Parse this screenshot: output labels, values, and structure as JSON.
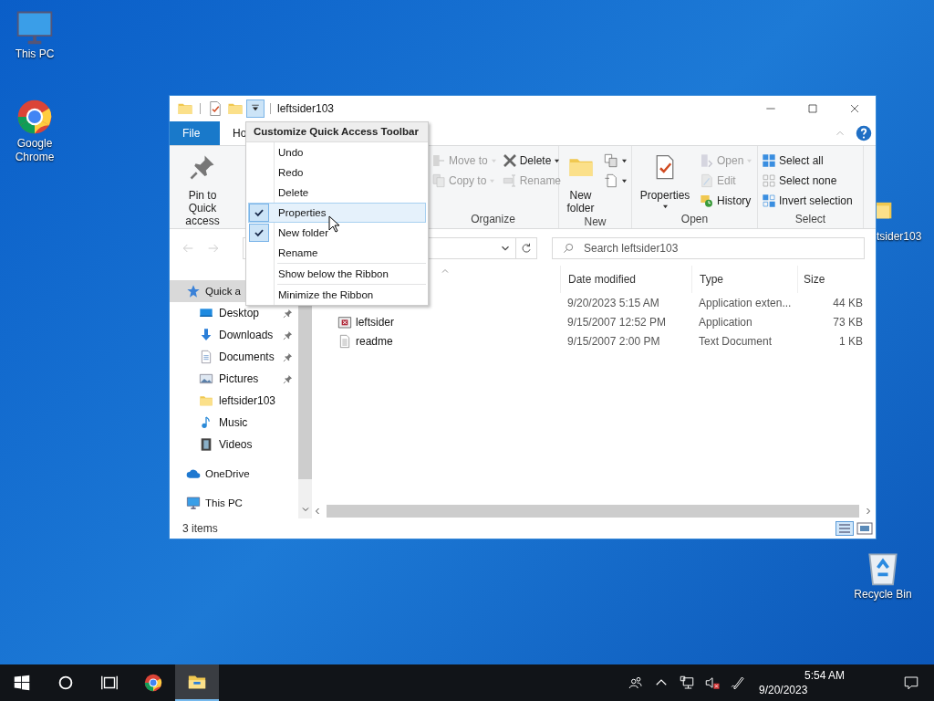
{
  "desktop_icons": [
    {
      "label": "This PC"
    },
    {
      "label": "Google Chrome"
    },
    {
      "label": "tsider103"
    },
    {
      "label": "Recycle Bin"
    }
  ],
  "window": {
    "title": "leftsider103",
    "tabs": [
      {
        "label": "File",
        "kind": "file"
      },
      {
        "label": "Ho",
        "kind": "tab"
      }
    ],
    "ribbon": [
      {
        "items": [
          {
            "label": "Pin to Quick access",
            "kind": "large",
            "disabled": false,
            "dropdown": false
          }
        ]
      },
      {
        "label": "Organize",
        "items": [
          {
            "label": "Move to",
            "kind": "small",
            "disabled": true,
            "dropdown": true
          },
          {
            "label": "Copy to",
            "kind": "small",
            "disabled": true,
            "dropdown": true
          },
          {
            "label": "Delete",
            "kind": "small",
            "disabled": false,
            "dropdown": true
          },
          {
            "label": "Rename",
            "kind": "small",
            "disabled": true,
            "dropdown": false
          }
        ]
      },
      {
        "label": "New",
        "items": [
          {
            "label": "New folder",
            "kind": "large",
            "disabled": false,
            "dropdown": false
          },
          {
            "kind": "small",
            "disabled": false,
            "dropdown": true
          },
          {
            "kind": "small",
            "disabled": false,
            "dropdown": true
          }
        ]
      },
      {
        "label": "Open",
        "items": [
          {
            "label": "Properties",
            "kind": "large",
            "disabled": false,
            "dropdown": true
          },
          {
            "label": "Open",
            "kind": "small",
            "disabled": true,
            "dropdown": true
          },
          {
            "label": "Edit",
            "kind": "small",
            "disabled": true,
            "dropdown": false
          },
          {
            "label": "History",
            "kind": "small",
            "disabled": false,
            "dropdown": false
          }
        ]
      },
      {
        "label": "Select",
        "items": [
          {
            "label": "Select all",
            "kind": "small",
            "disabled": false,
            "dropdown": false
          },
          {
            "label": "Select none",
            "kind": "small",
            "disabled": false,
            "dropdown": false
          },
          {
            "label": "Invert selection",
            "kind": "small",
            "disabled": false,
            "dropdown": false
          }
        ]
      }
    ],
    "search": {
      "placeholder": "Search leftsider103"
    },
    "navigation": [
      {
        "label": "Quick a",
        "pinned": false,
        "selected": true,
        "children": [
          {
            "label": "Desktop",
            "pinned": true,
            "selected": false
          },
          {
            "label": "Downloads",
            "pinned": true,
            "selected": false
          },
          {
            "label": "Documents",
            "pinned": true,
            "selected": false
          },
          {
            "label": "Pictures",
            "pinned": true,
            "selected": false
          },
          {
            "label": "leftsider103",
            "pinned": false,
            "selected": false
          },
          {
            "label": "Music",
            "pinned": false,
            "selected": false
          },
          {
            "label": "Videos",
            "pinned": false,
            "selected": false
          }
        ]
      },
      {
        "label": "OneDrive",
        "pinned": false,
        "selected": false
      },
      {
        "label": "This PC",
        "pinned": false,
        "selected": false
      }
    ],
    "table": {
      "columns": [
        "Date modified",
        "Type",
        "Size"
      ],
      "rows": [
        {
          "date": "9/20/2023 5:15 AM",
          "type": "Application exten...",
          "size": "44 KB"
        },
        {
          "name": "leftsider",
          "kind": "application",
          "date": "9/15/2007 12:52 PM",
          "type": "Application",
          "size": "73 KB"
        },
        {
          "name": "readme",
          "kind": "text",
          "date": "9/15/2007 2:00 PM",
          "type": "Text Document",
          "size": "1 KB"
        }
      ]
    },
    "status_bar": {
      "text": "3 items"
    },
    "menu": {
      "title": "Customize Quick Access Toolbar",
      "items": [
        {
          "kind": "item",
          "label": "Undo",
          "checked": false,
          "selected": false
        },
        {
          "kind": "item",
          "label": "Redo",
          "checked": false,
          "selected": false
        },
        {
          "kind": "item",
          "label": "Delete",
          "checked": false,
          "selected": false
        },
        {
          "kind": "item",
          "label": "Properties",
          "checked": true,
          "selected": true
        },
        {
          "kind": "item",
          "label": "New folder",
          "checked": true,
          "selected": false
        },
        {
          "kind": "item",
          "label": "Rename",
          "checked": false,
          "selected": false
        },
        {
          "kind": "separator"
        },
        {
          "kind": "item",
          "label": "Show below the Ribbon",
          "checked": false,
          "selected": false
        },
        {
          "kind": "separator"
        },
        {
          "kind": "item",
          "label": "Minimize the Ribbon",
          "checked": false,
          "selected": false
        }
      ]
    }
  },
  "taskbar": {
    "apps": [
      {
        "selected": false
      },
      {
        "selected": false
      },
      {
        "selected": false
      },
      {
        "selected": false
      },
      {
        "selected": true
      }
    ],
    "time": "5:54 AM",
    "date": "9/20/2023"
  }
}
